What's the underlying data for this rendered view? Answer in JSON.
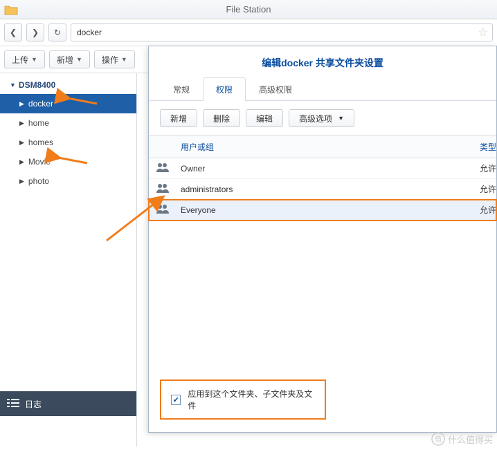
{
  "window": {
    "title": "File Station"
  },
  "nav": {
    "path_value": "docker"
  },
  "toolbar": {
    "upload": "上传",
    "new": "新增",
    "action": "操作"
  },
  "tree": {
    "root": "DSM8400",
    "items": [
      {
        "label": "docker",
        "selected": true
      },
      {
        "label": "home"
      },
      {
        "label": "homes"
      },
      {
        "label": "Movie"
      },
      {
        "label": "photo"
      }
    ]
  },
  "logs": {
    "label": "日志"
  },
  "panel": {
    "title": "编辑docker 共享文件夹设置",
    "tabs": {
      "general": "常规",
      "perm": "权限",
      "adv": "高级权限"
    },
    "tools": {
      "add": "新增",
      "del": "删除",
      "edit": "编辑",
      "advopt": "高级选项"
    },
    "thead": {
      "user": "用户或组",
      "type": "类型"
    },
    "rows": [
      {
        "name": "Owner",
        "type": "允许"
      },
      {
        "name": "administrators",
        "type": "允许"
      },
      {
        "name": "Everyone",
        "type": "允许"
      }
    ],
    "apply": "应用到这个文件夹、子文件夹及文件"
  },
  "watermark": "什么值得买"
}
